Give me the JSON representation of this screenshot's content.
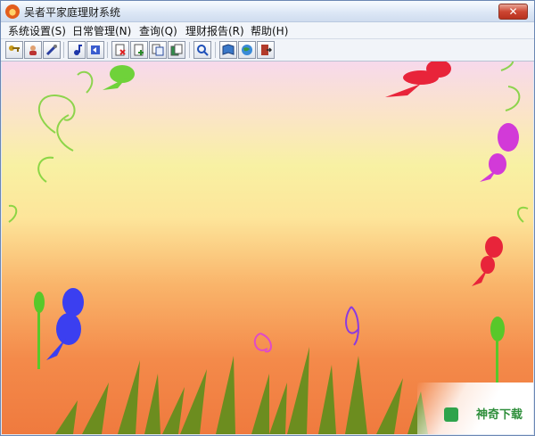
{
  "window": {
    "title": "吴者平家庭理财系统"
  },
  "menu": [
    {
      "label": "系统设置(S)"
    },
    {
      "label": "日常管理(N)"
    },
    {
      "label": "查询(Q)"
    },
    {
      "label": "理财报告(R)"
    },
    {
      "label": "帮助(H)"
    }
  ],
  "toolbar": {
    "buttons": [
      {
        "icon": "key-icon"
      },
      {
        "icon": "user-icon"
      },
      {
        "icon": "tools-icon"
      },
      {
        "icon": "music-note-icon"
      },
      {
        "icon": "return-icon"
      },
      {
        "icon": "document-delete-icon"
      },
      {
        "icon": "document-add-icon"
      },
      {
        "icon": "document-copy-icon"
      },
      {
        "icon": "documents-icon"
      },
      {
        "icon": "search-icon"
      },
      {
        "icon": "book-icon"
      },
      {
        "icon": "globe-icon"
      },
      {
        "icon": "exit-door-icon"
      }
    ]
  },
  "watermark": {
    "text": "神奇下载"
  },
  "colors": {
    "titlebar": "#dde8f6",
    "close": "#cc4632",
    "fairy_red": "#e8243a",
    "fairy_magenta": "#d23ad8",
    "fairy_blue": "#3b3ff0",
    "grass": "#5e8f1c"
  }
}
